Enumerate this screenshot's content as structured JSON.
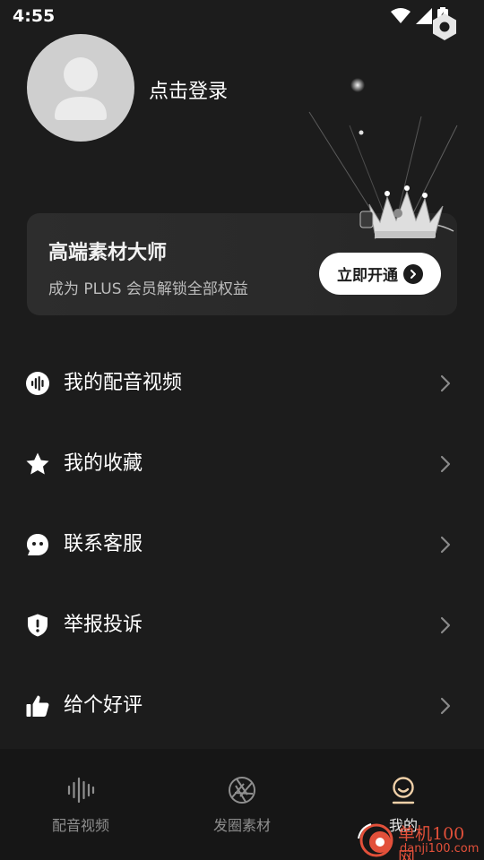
{
  "status_bar": {
    "time": "4:55"
  },
  "profile": {
    "login_label": "点击登录"
  },
  "vip_card": {
    "title": "高端素材大师",
    "subtitle": "成为 PLUS 会员解锁全部权益",
    "button_label": "立即开通"
  },
  "menu": {
    "items": [
      {
        "label": "我的配音视频",
        "icon": "voice-wave-icon"
      },
      {
        "label": "我的收藏",
        "icon": "star-icon"
      },
      {
        "label": "联系客服",
        "icon": "chat-face-icon"
      },
      {
        "label": "举报投诉",
        "icon": "shield-alert-icon"
      },
      {
        "label": "给个好评",
        "icon": "thumbs-up-icon"
      }
    ]
  },
  "bottom_nav": {
    "tabs": [
      {
        "label": "配音视频",
        "icon": "waveform-icon",
        "active": false
      },
      {
        "label": "发圈素材",
        "icon": "aperture-icon",
        "active": false
      },
      {
        "label": "我的",
        "icon": "user-face-icon",
        "active": true
      }
    ]
  },
  "watermark": {
    "text_cn": "单机100网",
    "text_en": "danji100.com"
  },
  "colors": {
    "background": "#1c1c1c",
    "card": "#2a2a2a",
    "nav_background": "#161616",
    "active_icon": "#f0d0a8",
    "watermark": "#e2503a"
  }
}
